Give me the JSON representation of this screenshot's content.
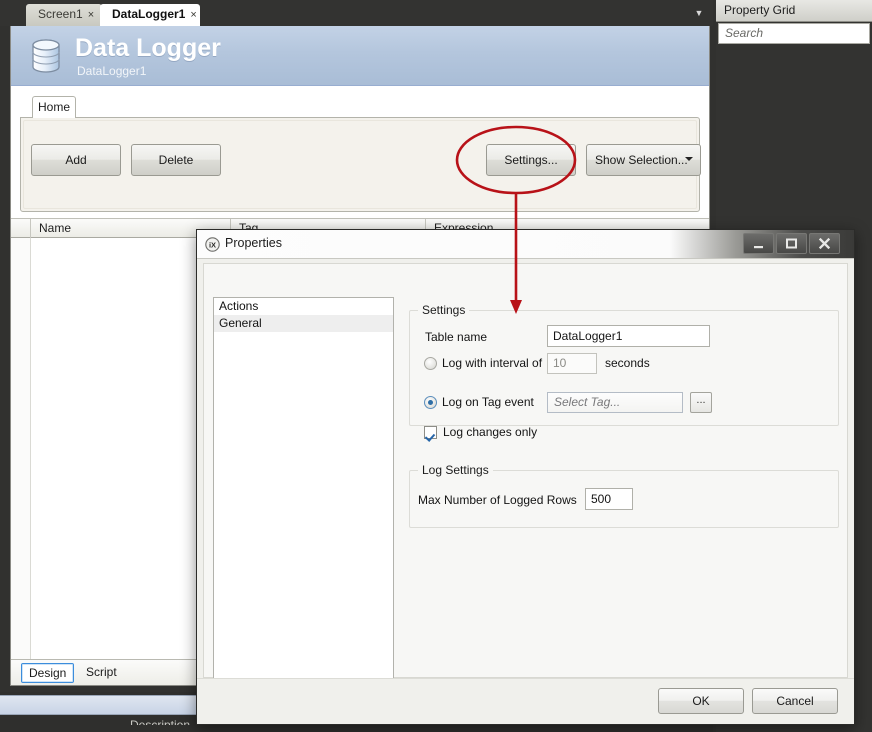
{
  "tabstrip": {
    "tabs": [
      {
        "label": "Screen1",
        "close": "×",
        "active": false
      },
      {
        "label": "DataLogger1",
        "close": "×",
        "active": true
      }
    ],
    "overflow_icon": "chevron-down-icon"
  },
  "banner": {
    "icon": "database-icon",
    "title": "Data Logger",
    "subtitle": "DataLogger1"
  },
  "ribbon": {
    "tab_label": "Home",
    "buttons": {
      "add": "Add",
      "delete": "Delete",
      "settings": "Settings...",
      "show_selection": "Show Selection..."
    }
  },
  "grid": {
    "columns": [
      "Name",
      "Tag",
      "Expression"
    ],
    "rows": []
  },
  "doc_tabs": {
    "design": "Design",
    "script": "Script",
    "selected": "Design"
  },
  "bottom": {
    "description_label": "Description"
  },
  "property_grid": {
    "title": "Property Grid",
    "search_placeholder": "Search",
    "search_value": ""
  },
  "dialog": {
    "logo": "ix-logo-icon",
    "title": "Properties",
    "window_buttons": {
      "minimize": "minimize-icon",
      "maximize": "maximize-icon",
      "close": "close-icon"
    },
    "categories": [
      {
        "label": "Actions",
        "selected": false
      },
      {
        "label": "General",
        "selected": true
      }
    ],
    "settings_group": {
      "legend": "Settings",
      "table_name_label": "Table name",
      "table_name_value": "DataLogger1",
      "log_interval_label": "Log with interval of",
      "log_interval_selected": false,
      "log_interval_value": "10",
      "log_interval_unit": "seconds",
      "log_on_tag_label": "Log on Tag event",
      "log_on_tag_selected": true,
      "tag_combo_placeholder": "Select Tag...",
      "tag_combo_value": "",
      "browse_button": "...",
      "log_changes_label": "Log changes only",
      "log_changes_checked": true
    },
    "log_settings_group": {
      "legend": "Log Settings",
      "max_rows_label": "Max Number of Logged Rows",
      "max_rows_value": "500"
    },
    "footer": {
      "ok": "OK",
      "cancel": "Cancel"
    }
  },
  "annotation": {
    "color": "#b81218",
    "ellipse_target": "settings-button",
    "arrow_target": "table-name-field"
  }
}
